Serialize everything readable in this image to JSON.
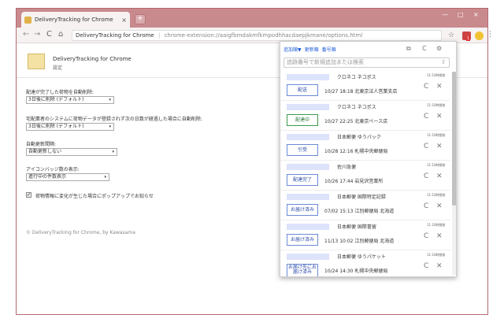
{
  "browser": {
    "tab_title": "DeliveryTracking for Chrome",
    "tab_close": "×",
    "new_tab": "+",
    "omnibox_title": "DeliveryTracking for Chrome",
    "omnibox_separator": "|",
    "omnibox_url": "chrome-extension://aaigfbmdakmfkmpodhhacdaepjkmane/options.html",
    "win_min": "—",
    "win_max": "□",
    "win_close": "×",
    "ext_badge": "1",
    "back_icon": "←",
    "forward_icon": "→",
    "reload_icon": "C",
    "home_icon": "⌂",
    "star_icon": "☆",
    "menu_icon": "⋮"
  },
  "options": {
    "title": "DeliveryTracking for Chrome",
    "subtitle": "設定",
    "setting1_label": "配達が完了した荷物を自動削除:",
    "setting1_value": "3日後に削除 (デフォルト)",
    "setting2_label": "宅配業者のシステムに荷物データが登録されず次の日数が経過した場合に自動削除:",
    "setting2_value": "3日後に削除 (デフォルト)",
    "setting3_label": "自動更新間隔:",
    "setting3_value": "自動更新しない",
    "setting4_label": "アイコンバッジ数の表示:",
    "setting4_value": "進行中の件数表示",
    "checkbox_label": "荷物情報に変化が生じた場合にポップアップでお知らせ",
    "checkbox_mark": "✓",
    "copyright": "© DeliveryTracking for Chrome, by Kawasama",
    "arrow": "▾"
  },
  "popup": {
    "links": [
      "追加順▼",
      "更新順",
      "番号順"
    ],
    "search_placeholder": "追跡番号で新規追加または検索",
    "search_icon": "⇧",
    "copy_icon": "⧉",
    "reload_icon": "C",
    "gear_icon": "⚙",
    "refresh_icon": "C",
    "delete_icon": "✕",
    "entries": [
      {
        "carrier": "クロネコ ネコポス",
        "status": "配送",
        "detail": "10/27 18:18 北東京法人営業支店",
        "update_time": "11:10時間前"
      },
      {
        "carrier": "クロネコ ネコポス",
        "status": "配達中",
        "detail": "10/27 22:25 北東京ベース店",
        "update_time": "11:10時間前"
      },
      {
        "carrier": "日本郵便 ゆうパック",
        "status": "引受",
        "detail": "10/28 12:16 札幌中央郵便局",
        "update_time": "11:10時間前"
      },
      {
        "carrier": "佐川急便",
        "status": "配達完了",
        "detail": "10/26 17:44 岩見沢営業所",
        "update_time": "11:10時間前"
      },
      {
        "carrier": "日本郵便 国際特定記録",
        "status": "お届け済み",
        "detail": "07/02 15:13 江別郵便局 北海道",
        "update_time": "11:10時間前"
      },
      {
        "carrier": "日本郵便 国際書留",
        "status": "お届け済み",
        "detail": "11/13 10:02 江別郵便局 北海道",
        "update_time": "11:10時間前"
      },
      {
        "carrier": "日本郵便 ゆうパケット",
        "status": "お届け先にお届け済み",
        "detail": "10/24 14:30 札幌中央郵便局",
        "update_time": "11:10時間前"
      }
    ]
  }
}
